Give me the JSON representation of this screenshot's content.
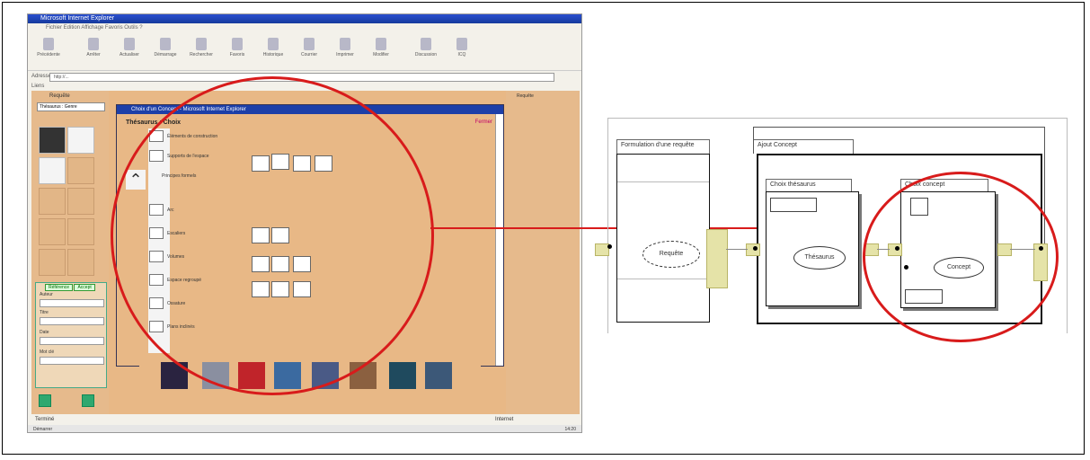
{
  "screenshot": {
    "window_title": "Microsoft Internet Explorer",
    "address_label": "Adresse",
    "address_value": "http://...",
    "links_label": "Liens",
    "menu": "Fichier  Edition  Affichage  Favoris  Outils  ?",
    "toolbar": [
      "Précédente",
      "Arrêter",
      "Actualiser",
      "Démarrage",
      "Rechercher",
      "Favoris",
      "Historique",
      "Courrier",
      "Imprimer",
      "Modifier",
      "Discussion",
      "ICQ"
    ],
    "left_panel": {
      "title": "Requête",
      "select_value": "Thésaurus : Genre",
      "form_tabs": [
        "Référence",
        "Accept"
      ],
      "form_labels": [
        "Auteur",
        "Titre",
        "Date",
        "Mot clé"
      ]
    },
    "right_strip_label": "Requête",
    "popup": {
      "title": "Choix d'un Concept - Microsoft Internet Explorer",
      "breadcrumb": "Thésaurus : Choix",
      "close_link": "Fermer",
      "rows": [
        "Éléments de construction",
        "Supports de l'espace",
        "Principes formels",
        "Arc",
        "Escaliers",
        "Volumes",
        "Espace regroupé",
        "Ossature",
        "Plans inclinés"
      ]
    },
    "status_left": "Terminé",
    "status_right": "Internet",
    "taskbar": "Démarrer",
    "clock": "14:20"
  },
  "diagram": {
    "box_formulation": "Formulation d'une requête",
    "box_ajout": "Ajout Concept",
    "box_choix_thesaurus": "Choix thésaurus",
    "box_choix_concept": "Choix concept",
    "ellipse_requete": "Requête",
    "ellipse_thesaurus": "Thésaurus",
    "ellipse_concept": "Concept"
  },
  "colors": {
    "highlight": "#d81b1b",
    "page_bg": "#e8b886",
    "port": "#e5e3a8"
  }
}
